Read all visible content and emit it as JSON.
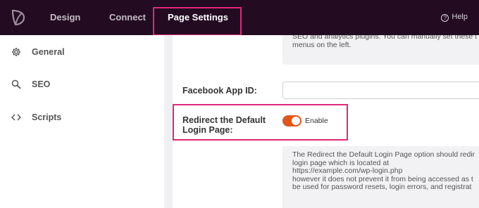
{
  "topbar": {
    "tabs": [
      {
        "label": "Design"
      },
      {
        "label": "Connect"
      },
      {
        "label": "Page Settings"
      }
    ],
    "help_label": "Help"
  },
  "sidebar": {
    "items": [
      {
        "label": "General",
        "icon": "gear-icon"
      },
      {
        "label": "SEO",
        "icon": "search-icon"
      },
      {
        "label": "Scripts",
        "icon": "code-icon"
      }
    ]
  },
  "main": {
    "top_info_lines": [
      "SEO and analytics plugins. You can manually set these t",
      "menus on the left."
    ],
    "facebook_label": "Facebook App ID:",
    "facebook_value": "",
    "redirect_label_line1": "Redirect the Default",
    "redirect_label_line2": "Login Page:",
    "toggle_label": "Enable",
    "toggle_on": true,
    "bottom_info_lines": [
      "The Redirect the Default Login Page option should redir",
      "login page which is located at",
      "https://example.com/wp-login.php",
      "however it does not prevent it from being accessed as t",
      "be used for password resets, login errors, and registrat"
    ]
  },
  "colors": {
    "topbar": "#230b22",
    "highlight": "#e0287a",
    "toggle": "#e2561a"
  }
}
